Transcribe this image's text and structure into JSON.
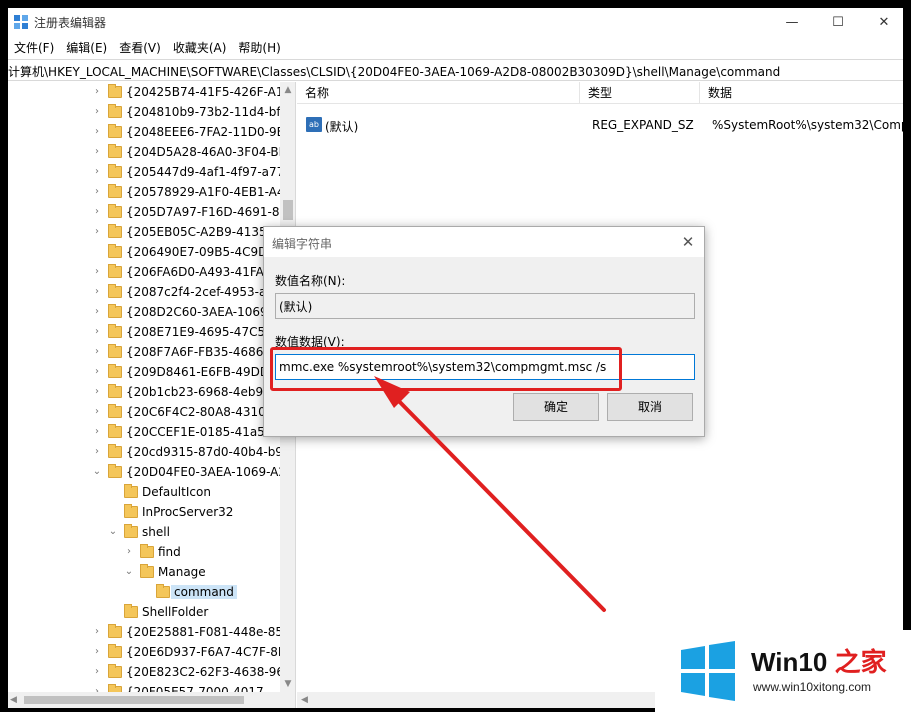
{
  "window": {
    "title": "注册表编辑器",
    "minimize": "—",
    "maximize": "☐",
    "close": "✕"
  },
  "menu": [
    "文件(F)",
    "编辑(E)",
    "查看(V)",
    "收藏夹(A)",
    "帮助(H)"
  ],
  "address": "计算机\\HKEY_LOCAL_MACHINE\\SOFTWARE\\Classes\\CLSID\\{20D04FE0-3AEA-1069-A2D8-08002B30309D}\\shell\\Manage\\command",
  "tree": [
    {
      "label": "{20425B74-41F5-426F-A14",
      "level": 0,
      "chevron": ">"
    },
    {
      "label": "{204810b9-73b2-11d4-bf4",
      "level": 0,
      "chevron": ">"
    },
    {
      "label": "{2048EEE6-7FA2-11D0-9E6",
      "level": 0,
      "chevron": ">"
    },
    {
      "label": "{204D5A28-46A0-3F04-BD",
      "level": 0,
      "chevron": ">"
    },
    {
      "label": "{205447d9-4af1-4f97-a773",
      "level": 0,
      "chevron": ">"
    },
    {
      "label": "{20578929-A1F0-4EB1-A4E",
      "level": 0,
      "chevron": ">"
    },
    {
      "label": "{205D7A97-F16D-4691-86E",
      "level": 0,
      "chevron": ">"
    },
    {
      "label": "{205EB05C-A2B9-4135-",
      "level": 0,
      "chevron": ">"
    },
    {
      "label": "{206490E7-09B5-4C9D-",
      "level": 0,
      "chevron": ""
    },
    {
      "label": "{206FA6D0-A493-41FA-",
      "level": 0,
      "chevron": ">"
    },
    {
      "label": "{2087c2f4-2cef-4953-a8",
      "level": 0,
      "chevron": ">"
    },
    {
      "label": "{208D2C60-3AEA-1069-",
      "level": 0,
      "chevron": ">"
    },
    {
      "label": "{208E71E9-4695-47C5-",
      "level": 0,
      "chevron": ">"
    },
    {
      "label": "{208F7A6F-FB35-4686-",
      "level": 0,
      "chevron": ">"
    },
    {
      "label": "{209D8461-E6FB-49DD-",
      "level": 0,
      "chevron": ">"
    },
    {
      "label": "{20b1cb23-6968-4eb9-",
      "level": 0,
      "chevron": ">"
    },
    {
      "label": "{20C6F4C2-80A8-4310-",
      "level": 0,
      "chevron": ">"
    },
    {
      "label": "{20CCEF1E-0185-41a5-A",
      "level": 0,
      "chevron": ">"
    },
    {
      "label": "{20cd9315-87d0-40b4-b9",
      "level": 0,
      "chevron": ">"
    },
    {
      "label": "{20D04FE0-3AEA-1069-A2",
      "level": 0,
      "chevron": "v"
    },
    {
      "label": "DefaultIcon",
      "level": 1,
      "chevron": ""
    },
    {
      "label": "InProcServer32",
      "level": 1,
      "chevron": ""
    },
    {
      "label": "shell",
      "level": 1,
      "chevron": "v"
    },
    {
      "label": "find",
      "level": 2,
      "chevron": ">"
    },
    {
      "label": "Manage",
      "level": 2,
      "chevron": "v"
    },
    {
      "label": "command",
      "level": 3,
      "chevron": "",
      "selected": true
    },
    {
      "label": "ShellFolder",
      "level": 1,
      "chevron": ""
    },
    {
      "label": "{20E25881-F081-448e-85C",
      "level": 0,
      "chevron": ">"
    },
    {
      "label": "{20E6D937-F6A7-4C7F-8E6",
      "level": 0,
      "chevron": ">"
    },
    {
      "label": "{20E823C2-62F3-4638-96E",
      "level": 0,
      "chevron": ">"
    },
    {
      "label": "{20F05E57-7000-4017-",
      "level": 0,
      "chevron": ">"
    }
  ],
  "list": {
    "columns": [
      "名称",
      "类型",
      "数据"
    ],
    "rows": [
      {
        "icon": "ab",
        "name": "(默认)",
        "type": "REG_EXPAND_SZ",
        "data": "%SystemRoot%\\system32\\Comp"
      }
    ]
  },
  "dialog": {
    "title": "编辑字符串",
    "close": "✕",
    "name_label": "数值名称(N):",
    "name_value": "(默认)",
    "data_label": "数值数据(V):",
    "data_value": "mmc.exe %systemroot%\\system32\\compmgmt.msc /s",
    "ok_label": "确定",
    "cancel_label": "取消"
  },
  "watermark": {
    "title_latin": "Win10",
    "title_cjk": "之家",
    "url": "www.win10xitong.com"
  },
  "colors": {
    "accent": "#0078d7",
    "highlight_red": "#e02020",
    "folder": "#f4c65a"
  }
}
